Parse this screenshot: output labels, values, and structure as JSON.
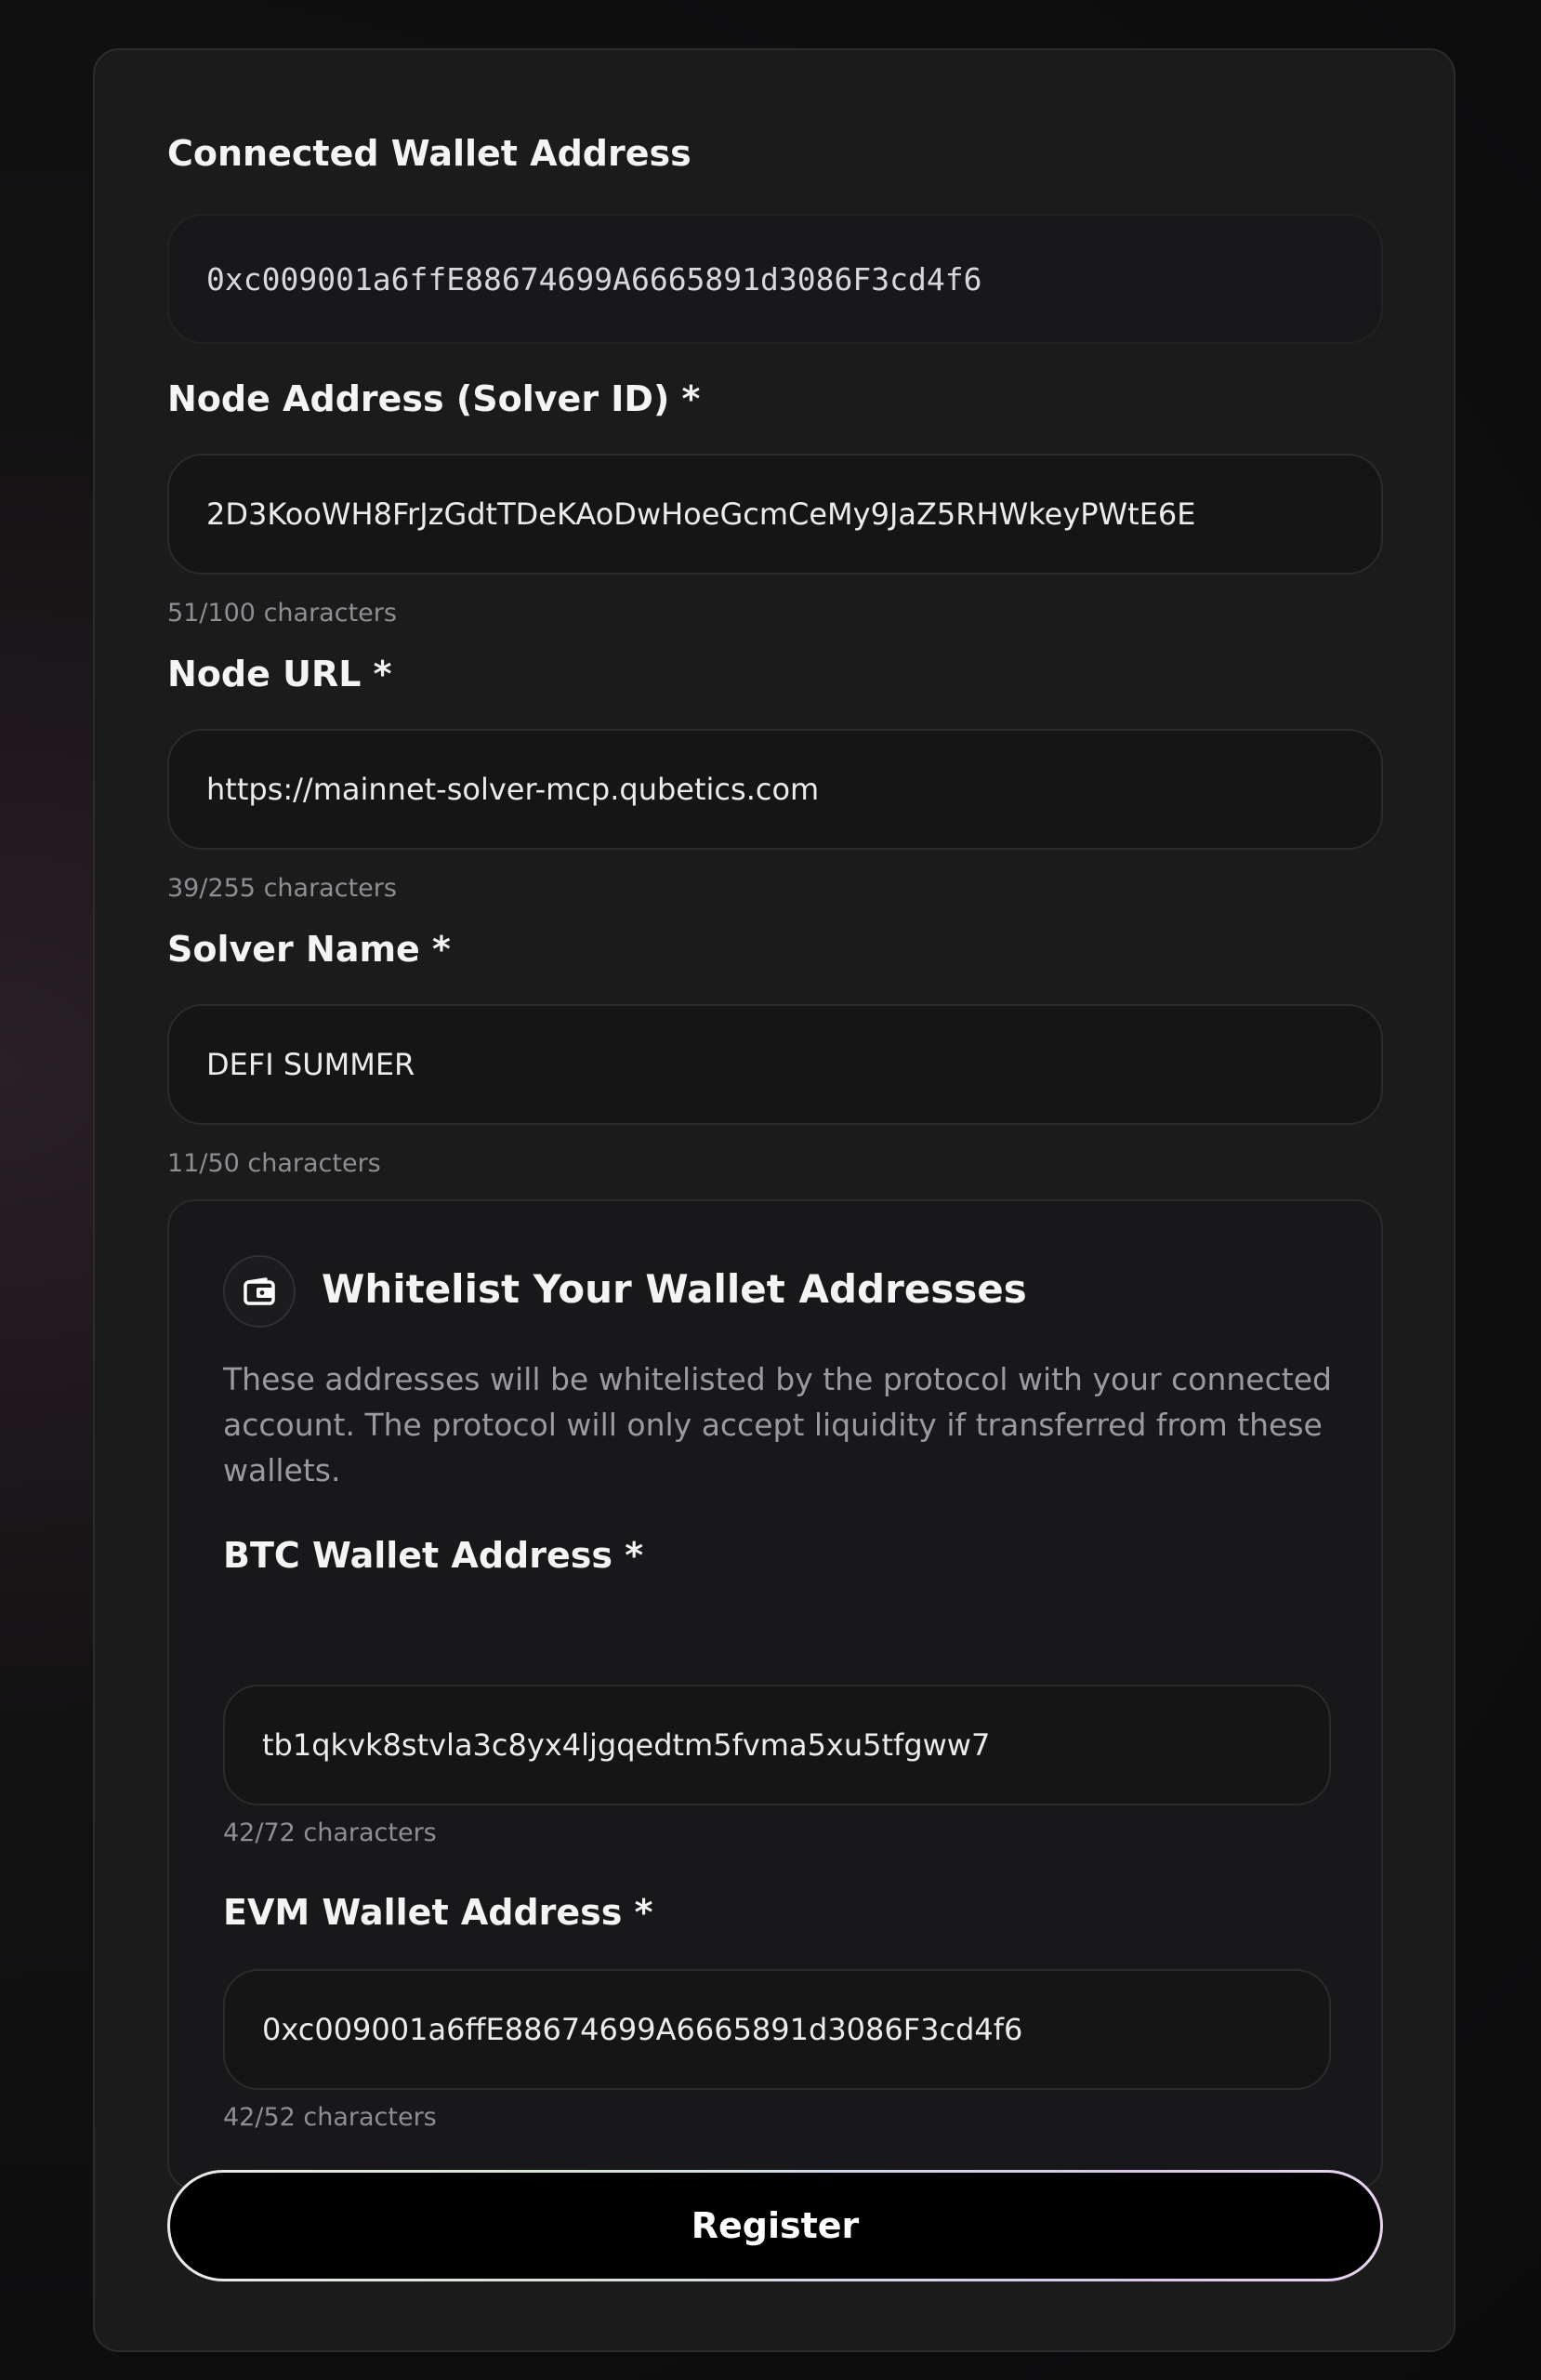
{
  "connected_wallet": {
    "label": "Connected Wallet Address",
    "value": "0xc009001a6ffE88674699A6665891d3086F3cd4f6"
  },
  "node_address": {
    "label": "Node Address (Solver ID) *",
    "value": "2D3KooWH8FrJzGdtTDeKAoDwHoeGcmCeMy9JaZ5RHWkeyPWtE6E",
    "count": "51/100 characters"
  },
  "node_url": {
    "label": "Node URL *",
    "value": "https://mainnet-solver-mcp.qubetics.com",
    "count": "39/255 characters"
  },
  "solver_name": {
    "label": "Solver Name *",
    "value": "DEFI SUMMER",
    "count": "11/50 characters"
  },
  "whitelist": {
    "icon": "wallet-icon",
    "title": "Whitelist Your Wallet Addresses",
    "description": "These addresses will be whitelisted by the protocol with your connected account. The protocol will only accept liquidity if transferred from these wallets.",
    "btc": {
      "label": "BTC Wallet Address *",
      "value": "tb1qkvk8stvla3c8yx4ljgqedtm5fvma5xu5tfgww7",
      "count": "42/72 characters"
    },
    "evm": {
      "label": "EVM Wallet Address *",
      "value": "0xc009001a6ffE88674699A6665891d3086F3cd4f6",
      "count": "42/52 characters"
    }
  },
  "register_label": "Register"
}
